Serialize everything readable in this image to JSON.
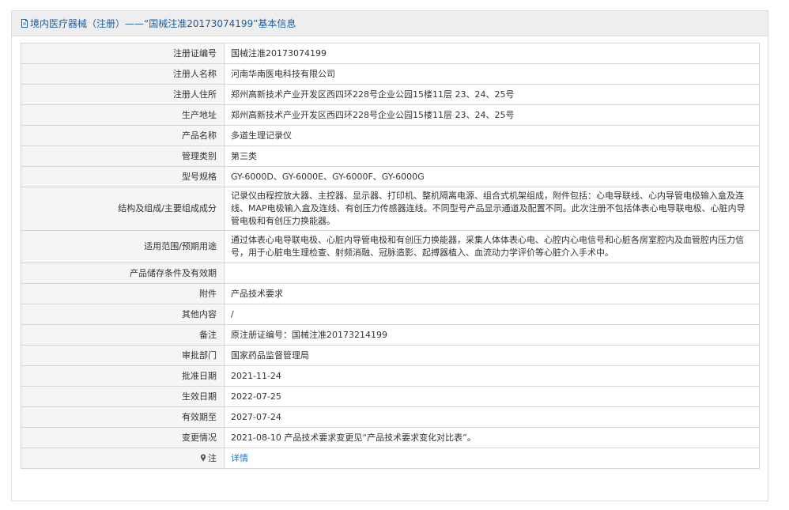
{
  "header": {
    "title": "境内医疗器械（注册）——“国械注准20173074199”基本信息"
  },
  "rows": [
    {
      "label": "注册证编号",
      "value": "国械注准20173074199"
    },
    {
      "label": "注册人名称",
      "value": "河南华南医电科技有限公司"
    },
    {
      "label": "注册人住所",
      "value": "郑州高新技术产业开发区西四环228号企业公园15楼11层 23、24、25号"
    },
    {
      "label": "生产地址",
      "value": "郑州高新技术产业开发区西四环228号企业公园15楼11层 23、24、25号"
    },
    {
      "label": "产品名称",
      "value": "多道生理记录仪"
    },
    {
      "label": "管理类别",
      "value": "第三类"
    },
    {
      "label": "型号规格",
      "value": "GY-6000D、GY-6000E、GY-6000F、GY-6000G"
    },
    {
      "label": "结构及组成/主要组成成分",
      "value": "记录仪由程控放大器、主控器、显示器、打印机、整机隔离电源、组合式机架组成，附件包括：心电导联线、心内导管电极输入盒及连线、MAP电极输入盒及连线、有创压力传感器连线。不同型号产品显示通道及配置不同。此次注册不包括体表心电导联电极、心脏内导管电极和有创压力换能器。"
    },
    {
      "label": "适用范围/预期用途",
      "value": "通过体表心电导联电极、心脏内导管电极和有创压力换能器，采集人体体表心电、心腔内心电信号和心脏各房室腔内及血管腔内压力信号，用于心脏电生理检查、射频消融、冠脉造影、起搏器植入、血流动力学评价等心脏介入手术中。"
    },
    {
      "label": "产品储存条件及有效期",
      "value": ""
    },
    {
      "label": "附件",
      "value": "产品技术要求"
    },
    {
      "label": "其他内容",
      "value": "/"
    },
    {
      "label": "备注",
      "value": "原注册证编号：国械注准20173214199"
    },
    {
      "label": "审批部门",
      "value": "国家药品监督管理局"
    },
    {
      "label": "批准日期",
      "value": "2021-11-24"
    },
    {
      "label": "生效日期",
      "value": "2022-07-25"
    },
    {
      "label": "有效期至",
      "value": "2027-07-24"
    },
    {
      "label": "变更情况",
      "value": "2021-08-10 产品技术要求变更见“产品技术要求变化对比表”。"
    },
    {
      "label": "注",
      "value": "详情"
    }
  ],
  "icons": {
    "header_icon": "document-icon",
    "note_icon": "pin-icon"
  },
  "colors": {
    "header_text": "#1d5d9b",
    "link": "#1d73c9",
    "label_bg": "#f5f5f5",
    "header_bg": "#eeeeee"
  }
}
